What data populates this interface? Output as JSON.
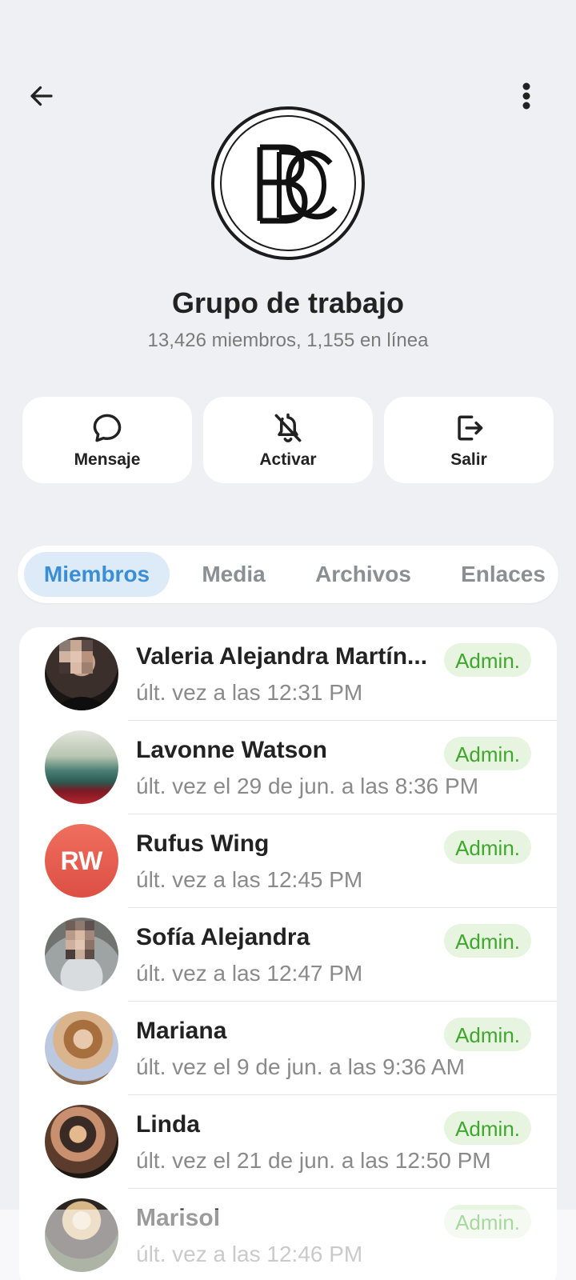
{
  "header": {
    "back_icon": "arrow-left-icon",
    "more_icon": "more-vertical-icon",
    "avatar_icon": "bdc-logo"
  },
  "group": {
    "title": "Grupo de trabajo",
    "subtitle": "13,426 miembros, 1,155 en línea"
  },
  "actions": [
    {
      "label": "Mensaje",
      "icon": "chat-bubble-icon"
    },
    {
      "label": "Activar",
      "icon": "bell-off-icon"
    },
    {
      "label": "Salir",
      "icon": "exit-icon"
    }
  ],
  "tabs": [
    {
      "label": "Miembros",
      "active": true
    },
    {
      "label": "Media",
      "active": false
    },
    {
      "label": "Archivos",
      "active": false
    },
    {
      "label": "Enlaces",
      "active": false
    }
  ],
  "members": [
    {
      "name": "Valeria Alejandra Martín...",
      "status": "últ. vez a las 12:31 PM",
      "badge": "Admin."
    },
    {
      "name": "Lavonne Watson",
      "status": "últ. vez el 29 de jun. a las 8:36 PM",
      "badge": "Admin."
    },
    {
      "name": "Rufus Wing",
      "status": "últ. vez a las 12:45 PM",
      "badge": "Admin.",
      "initials": "RW"
    },
    {
      "name": "Sofía Alejandra",
      "status": "últ. vez a las 12:47 PM",
      "badge": "Admin."
    },
    {
      "name": "Mariana",
      "status": "últ. vez el 9 de jun. a las 9:36 AM",
      "badge": "Admin."
    },
    {
      "name": "Linda",
      "status": "últ. vez el 21 de jun. a las 12:50 PM",
      "badge": "Admin."
    },
    {
      "name": "Marisol",
      "status": "últ. vez a las 12:46 PM",
      "badge": "Admin."
    }
  ],
  "colors": {
    "background": "#eff0f4",
    "accent": "#3a8ed6",
    "admin_badge_text": "#3fa72e",
    "admin_badge_bg": "#e6f4e0"
  }
}
